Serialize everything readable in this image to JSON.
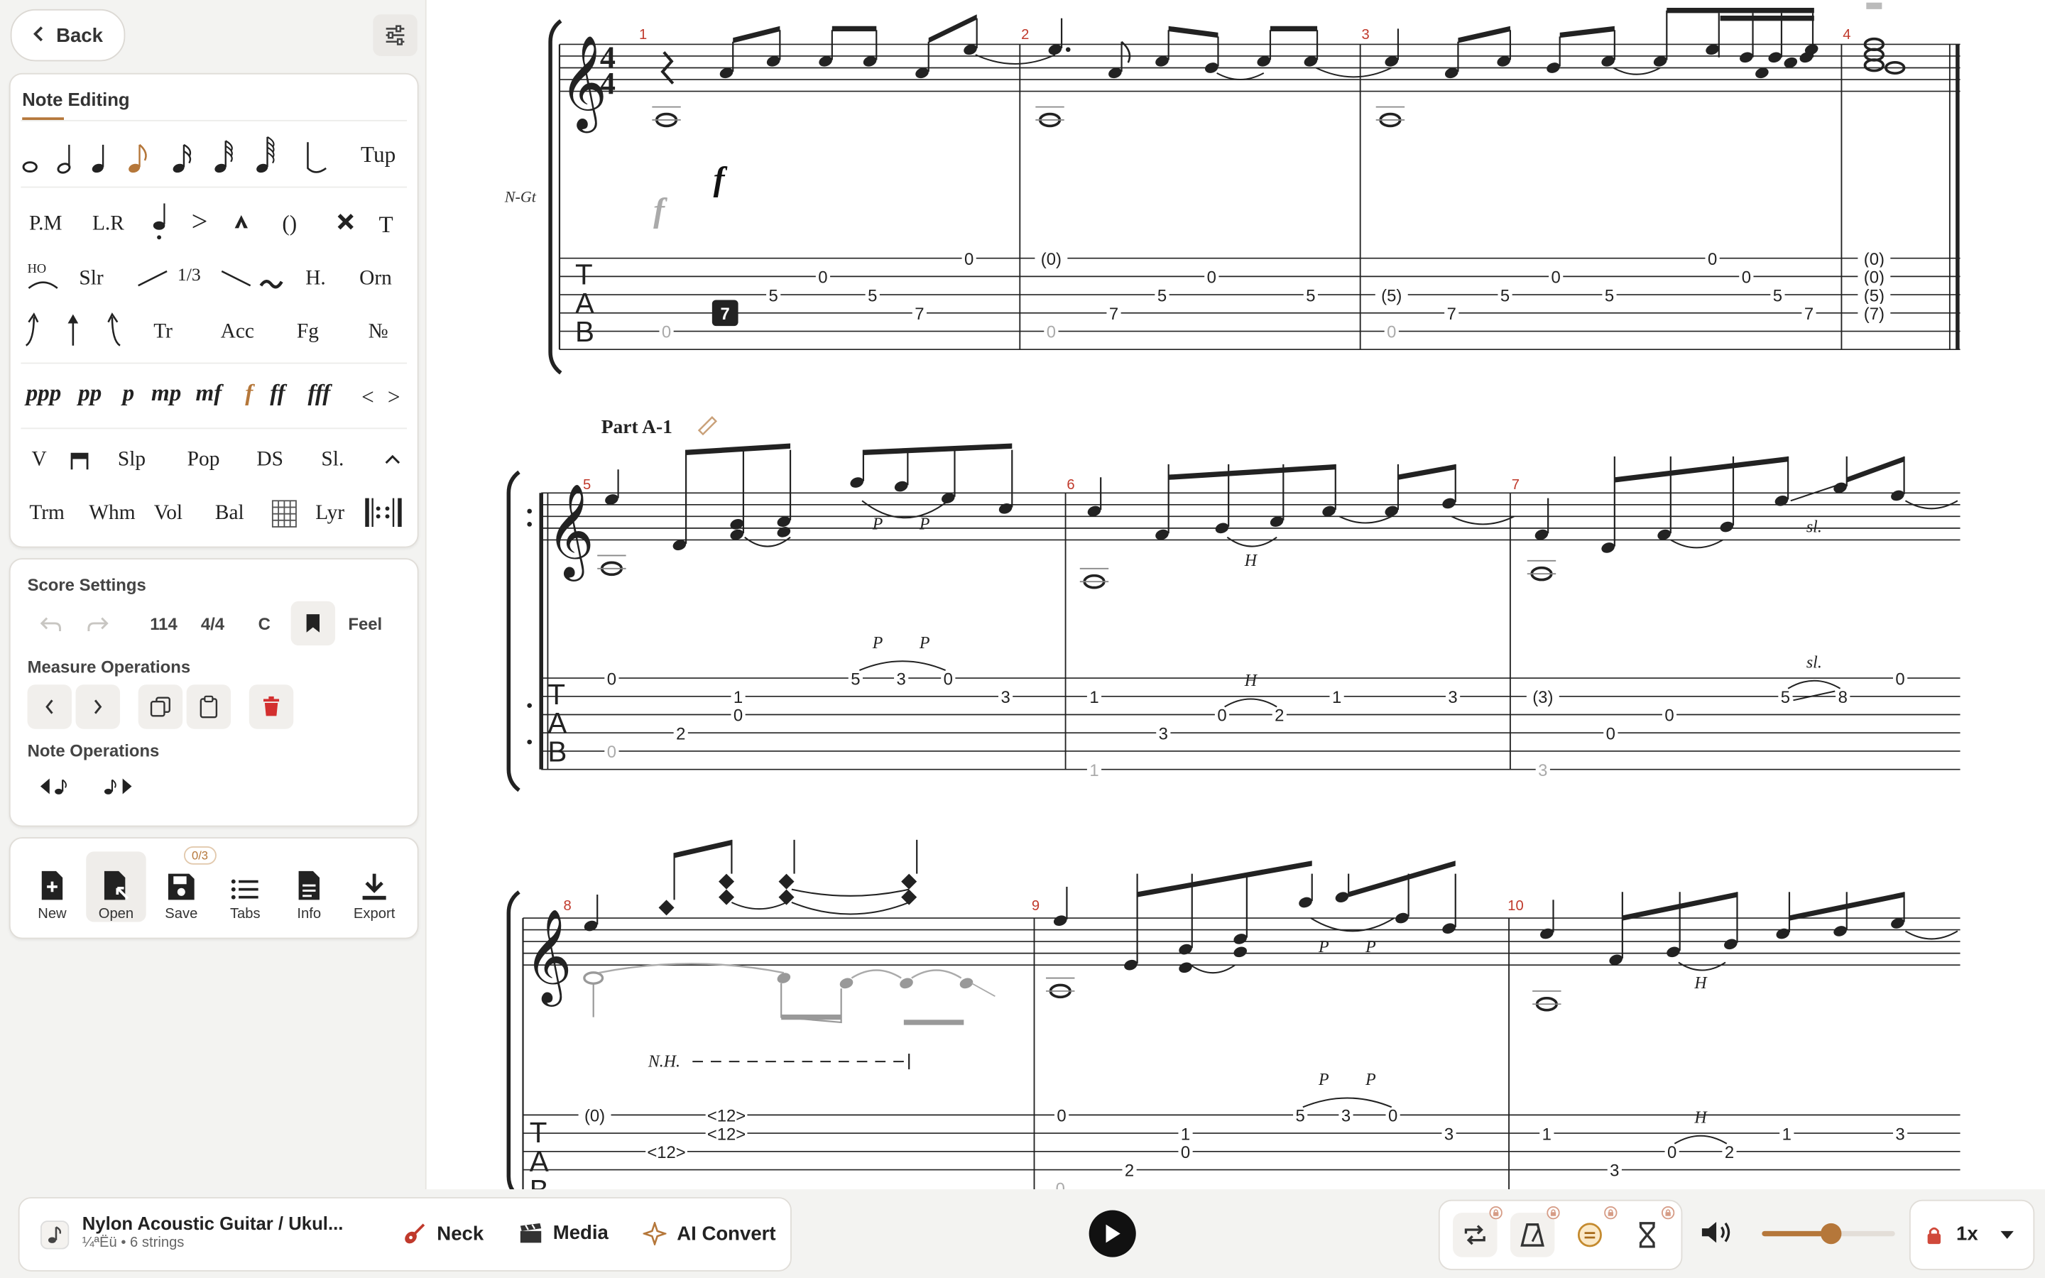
{
  "nav": {
    "back_label": "Back"
  },
  "note_editing": {
    "title": "Note Editing",
    "row1_tup": "Tup",
    "row2": [
      "P.M",
      "L.R",
      ">",
      "()",
      "T"
    ],
    "row3": [
      "HO",
      "Slr",
      "1/3",
      "H.",
      "Orn"
    ],
    "row4": [
      "Tr",
      "Acc",
      "Fg",
      "№"
    ],
    "dynamics": [
      "ppp",
      "pp",
      "p",
      "mp",
      "mf",
      "f",
      "ff",
      "fff"
    ],
    "dyn_arrows": [
      "<",
      ">"
    ],
    "row6": [
      "V",
      "Slp",
      "Pop",
      "DS",
      "Sl."
    ],
    "row7": [
      "Trm",
      "Whm",
      "Vol",
      "Bal",
      "Lyr"
    ]
  },
  "score_settings": {
    "title": "Score Settings",
    "tempo": "114",
    "time_sig": "4/4",
    "key": "C",
    "feel_label": "Feel",
    "measure_ops_title": "Measure Operations",
    "note_ops_title": "Note Operations"
  },
  "file_ops": {
    "new": "New",
    "open": "Open",
    "save": "Save",
    "save_badge": "0/3",
    "tabs": "Tabs",
    "info": "Info",
    "export": "Export"
  },
  "score": {
    "instrument_abbr": "N-Gt",
    "part_label": "Part A-1",
    "measure_numbers": [
      "1",
      "2",
      "3",
      "4",
      "5",
      "6",
      "7",
      "8",
      "9",
      "10"
    ],
    "time_signature": "4/4",
    "tab_letters": [
      "T",
      "A",
      "B"
    ],
    "system1_tab": [
      "0",
      "5",
      "0",
      "5",
      "7",
      "0",
      "(0)",
      "7",
      "5",
      "0",
      "5",
      "(5)",
      "7",
      "5",
      "0",
      "5",
      "0",
      "0",
      "5",
      "7",
      "(0)",
      "(0)",
      "(5)",
      "(7)",
      "7"
    ],
    "system2_tab": [
      "0",
      "1",
      "0",
      "2",
      "5",
      "3",
      "0",
      "3",
      "1",
      "3",
      "0",
      "2",
      "1",
      "3",
      "(3)",
      "0",
      "0",
      "5",
      "8",
      "0",
      "1",
      "3"
    ],
    "system2_marks": [
      "P",
      "P",
      "H",
      "sl."
    ],
    "system3_tab": [
      "(0)",
      "<12>",
      "<12>",
      "<12>",
      "0",
      "1",
      "0",
      "2",
      "5",
      "3",
      "0",
      "3",
      "1",
      "3",
      "0",
      "2",
      "1",
      "3"
    ],
    "system3_marks": [
      "P",
      "P",
      "H",
      "N.H."
    ],
    "dynamic_mark": "f",
    "ghost_dynamic": "f"
  },
  "bottom": {
    "instrument_name": "Nylon Acoustic Guitar / Ukul...",
    "instrument_sub": "¼ªËü • 6 strings",
    "neck_label": "Neck",
    "media_label": "Media",
    "ai_label": "AI Convert",
    "speed_label": "1x",
    "volume_level": 0.52
  },
  "colors": {
    "accent": "#b5773a",
    "measure_number": "#c0392b",
    "delete": "#d32f2f"
  }
}
